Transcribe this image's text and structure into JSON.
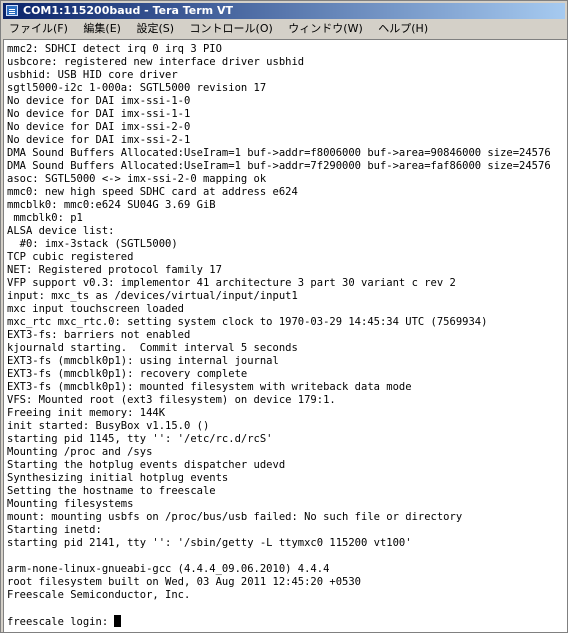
{
  "window": {
    "title": "COM1:115200baud - Tera Term VT"
  },
  "menu": [
    "ファイル(F)",
    "編集(E)",
    "設定(S)",
    "コントロール(O)",
    "ウィンドウ(W)",
    "ヘルプ(H)"
  ],
  "terminal": {
    "lines": [
      "mmc2: SDHCI detect irq 0 irq 3 PIO",
      "usbcore: registered new interface driver usbhid",
      "usbhid: USB HID core driver",
      "sgtl5000-i2c 1-000a: SGTL5000 revision 17",
      "No device for DAI imx-ssi-1-0",
      "No device for DAI imx-ssi-1-1",
      "No device for DAI imx-ssi-2-0",
      "No device for DAI imx-ssi-2-1",
      "DMA Sound Buffers Allocated:UseIram=1 buf->addr=f8006000 buf->area=90846000 size=24576",
      "DMA Sound Buffers Allocated:UseIram=1 buf->addr=7f290000 buf->area=faf86000 size=24576",
      "asoc: SGTL5000 <-> imx-ssi-2-0 mapping ok",
      "mmc0: new high speed SDHC card at address e624",
      "mmcblk0: mmc0:e624 SU04G 3.69 GiB",
      " mmcblk0: p1",
      "ALSA device list:",
      "  #0: imx-3stack (SGTL5000)",
      "TCP cubic registered",
      "NET: Registered protocol family 17",
      "VFP support v0.3: implementor 41 architecture 3 part 30 variant c rev 2",
      "input: mxc_ts as /devices/virtual/input/input1",
      "mxc input touchscreen loaded",
      "mxc_rtc mxc_rtc.0: setting system clock to 1970-03-29 14:45:34 UTC (7569934)",
      "EXT3-fs: barriers not enabled",
      "kjournald starting.  Commit interval 5 seconds",
      "EXT3-fs (mmcblk0p1): using internal journal",
      "EXT3-fs (mmcblk0p1): recovery complete",
      "EXT3-fs (mmcblk0p1): mounted filesystem with writeback data mode",
      "VFS: Mounted root (ext3 filesystem) on device 179:1.",
      "Freeing init memory: 144K",
      "init started: BusyBox v1.15.0 ()",
      "starting pid 1145, tty '': '/etc/rc.d/rcS'",
      "Mounting /proc and /sys",
      "Starting the hotplug events dispatcher udevd",
      "Synthesizing initial hotplug events",
      "Setting the hostname to freescale",
      "Mounting filesystems",
      "mount: mounting usbfs on /proc/bus/usb failed: No such file or directory",
      "Starting inetd:",
      "starting pid 2141, tty '': '/sbin/getty -L ttymxc0 115200 vt100'",
      "",
      "arm-none-linux-gnueabi-gcc (4.4.4_09.06.2010) 4.4.4",
      "root filesystem built on Wed, 03 Aug 2011 12:45:20 +0530",
      "Freescale Semiconductor, Inc.",
      "",
      "freescale login: "
    ]
  },
  "colors": {
    "titlebar_start": "#0a246a",
    "titlebar_end": "#a6caf0",
    "terminal_bg": "#ffffff",
    "terminal_fg": "#000000"
  }
}
